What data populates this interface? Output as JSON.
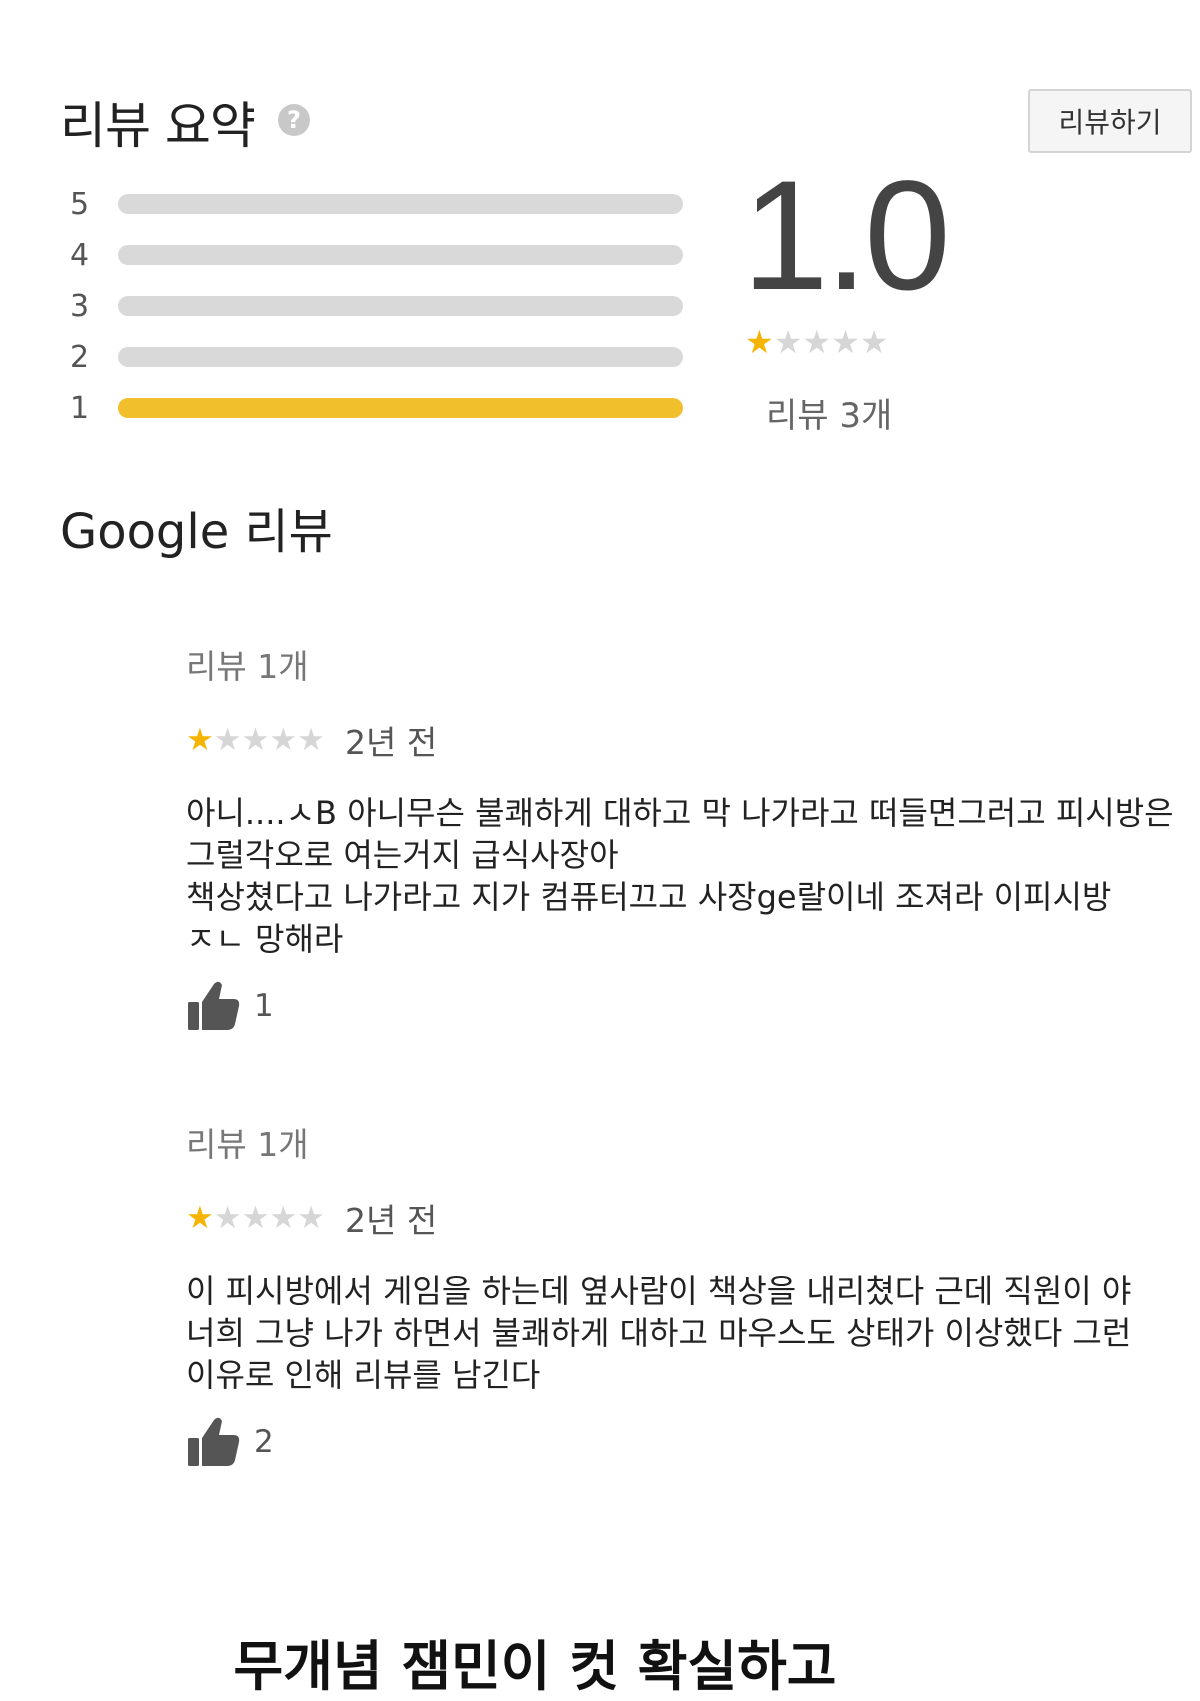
{
  "summary": {
    "title": "리뷰 요약",
    "help_icon": "question-circle-icon",
    "write_review_label": "리뷰하기",
    "rating": "1.0",
    "rating_stars": 1,
    "review_total": "리뷰 3개",
    "histogram": [
      {
        "label": "5",
        "fraction": 0
      },
      {
        "label": "4",
        "fraction": 0
      },
      {
        "label": "3",
        "fraction": 0
      },
      {
        "label": "2",
        "fraction": 0
      },
      {
        "label": "1",
        "fraction": 1
      }
    ]
  },
  "google_reviews": {
    "title": "Google 리뷰",
    "reviews": [
      {
        "count": "리뷰 1개",
        "stars": 1,
        "date": "2년 전",
        "text": "아니....ㅅB 아니무슨 불쾌하게 대하고 막 나가라고 떠들면그러고 피시방은 그럴각오로 여는거지 급식사장아\n책상쳤다고 나가라고 지가 컴퓨터끄고 사장ge랄이네 조져라 이피시방 ㅈㄴ 망해라",
        "likes": "1"
      },
      {
        "count": "리뷰 1개",
        "stars": 1,
        "date": "2년 전",
        "text": "이 피시방에서 게임을 하는데 옆사람이 책상을 내리쳤다 근데 직원이 야 너희 그냥 나가 하면서 불쾌하게 대하고 마우스도 상태가 이상했다 그런 이유로 인해 리뷰를 남긴다",
        "likes": "2"
      }
    ]
  },
  "caption": "무개념 잼민이 컷 확실하고",
  "colors": {
    "star_filled": "#f4b400",
    "star_empty": "#d6d6d6",
    "bar_filled": "#f1bf2c",
    "bar_empty": "#d9d9d9"
  }
}
